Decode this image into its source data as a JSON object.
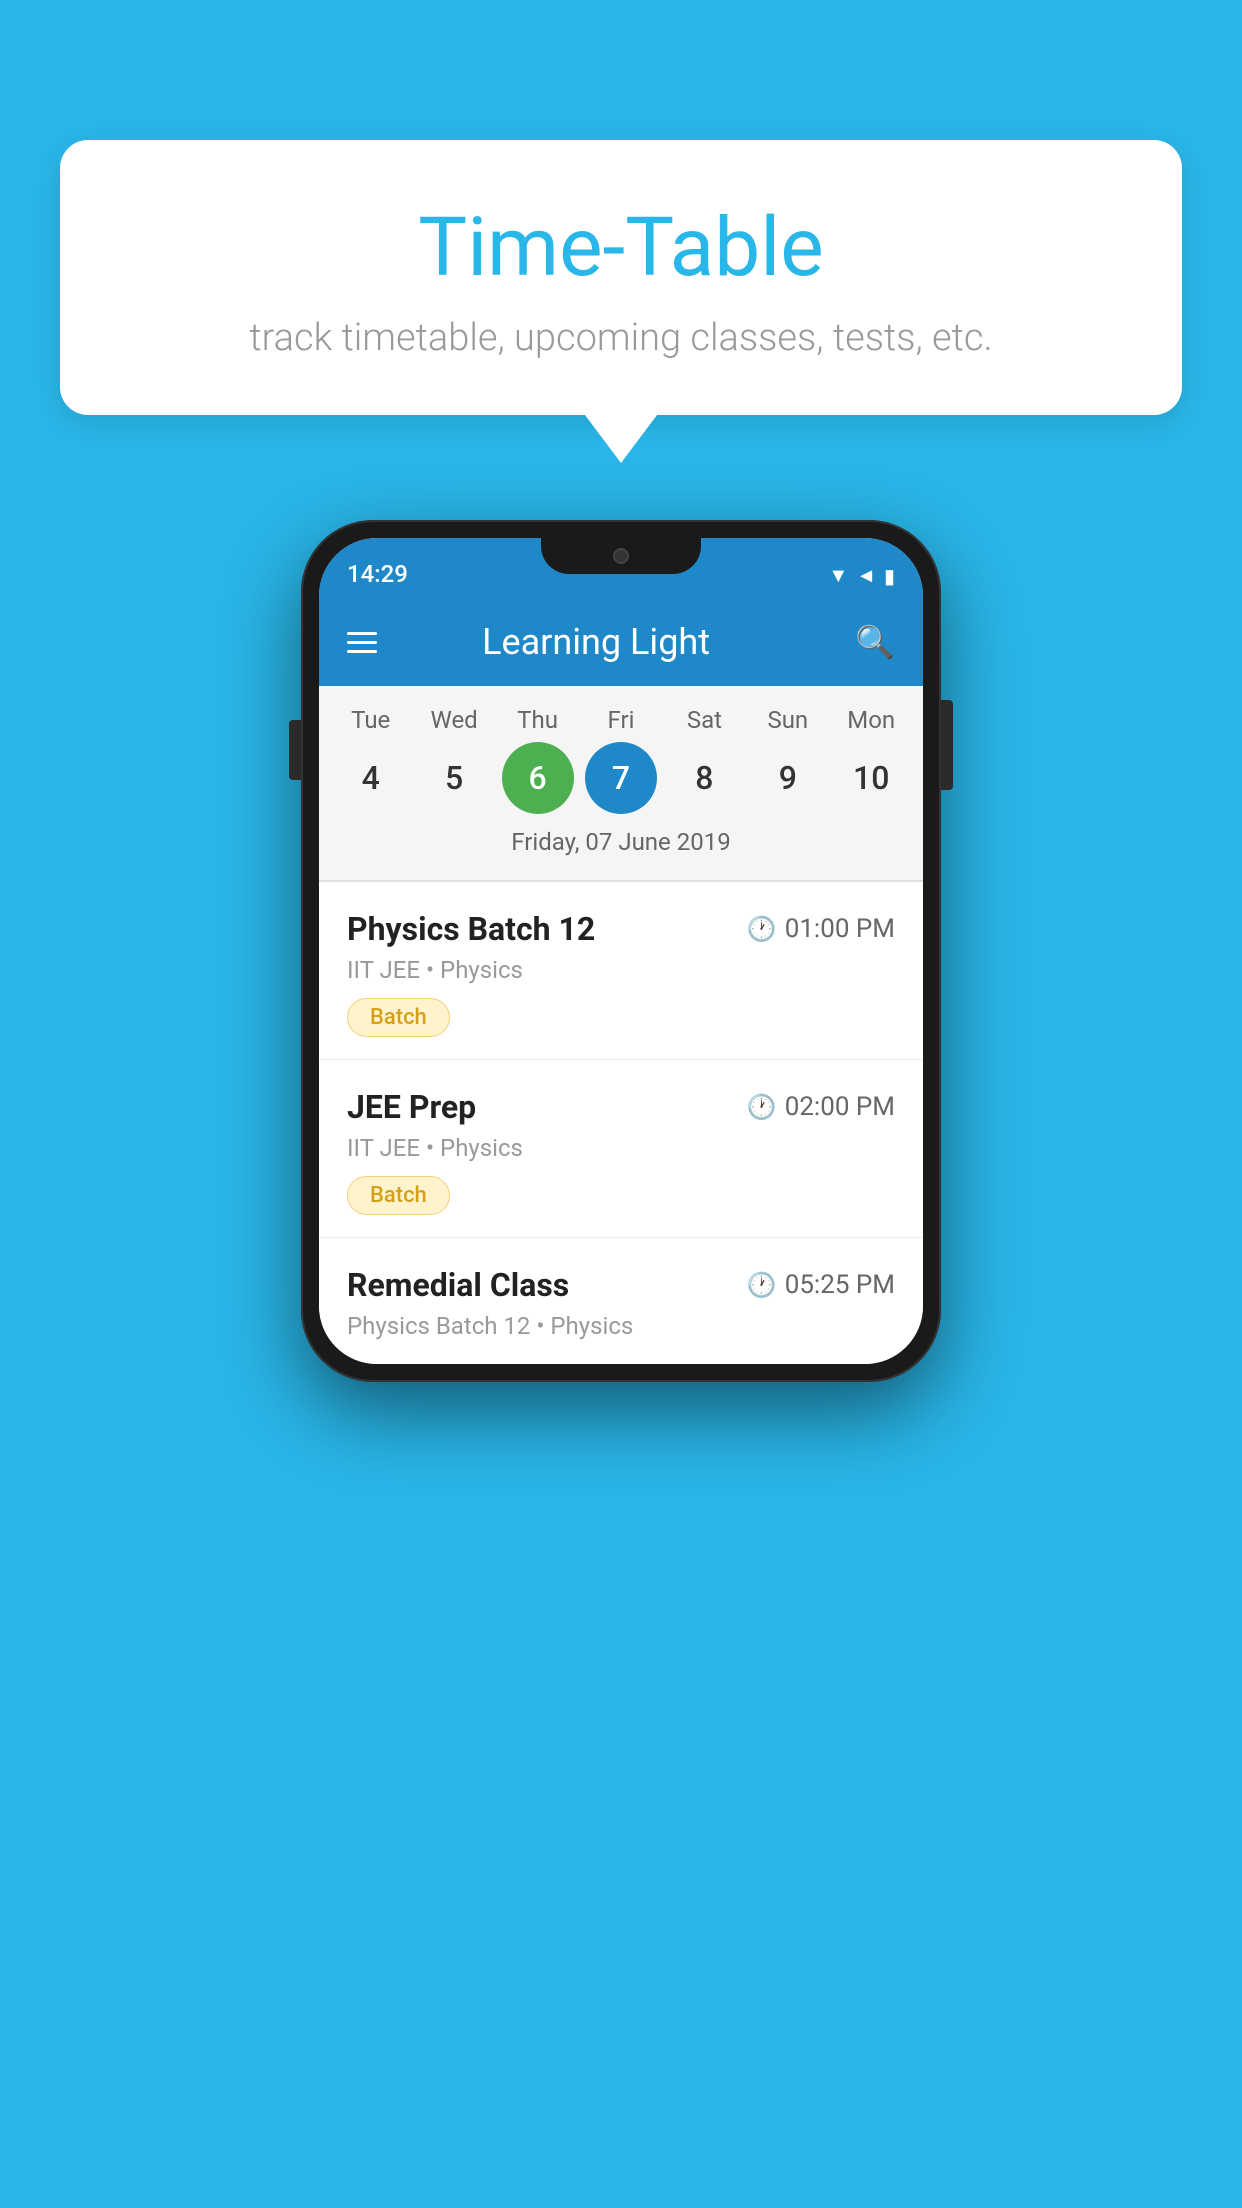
{
  "background_color": "#29B6E8",
  "speech_bubble": {
    "title": "Time-Table",
    "subtitle": "track timetable, upcoming classes, tests, etc."
  },
  "phone": {
    "status_bar": {
      "time": "14:29"
    },
    "header": {
      "title": "Learning Light"
    },
    "calendar": {
      "days": [
        {
          "label": "Tue",
          "num": "4"
        },
        {
          "label": "Wed",
          "num": "5"
        },
        {
          "label": "Thu",
          "num": "6",
          "state": "today"
        },
        {
          "label": "Fri",
          "num": "7",
          "state": "selected"
        },
        {
          "label": "Sat",
          "num": "8"
        },
        {
          "label": "Sun",
          "num": "9"
        },
        {
          "label": "Mon",
          "num": "10"
        }
      ],
      "selected_date_label": "Friday, 07 June 2019"
    },
    "schedule": [
      {
        "name": "Physics Batch 12",
        "time": "01:00 PM",
        "sub": "IIT JEE • Physics",
        "tag": "Batch"
      },
      {
        "name": "JEE Prep",
        "time": "02:00 PM",
        "sub": "IIT JEE • Physics",
        "tag": "Batch"
      },
      {
        "name": "Remedial Class",
        "time": "05:25 PM",
        "sub": "Physics Batch 12 • Physics"
      }
    ]
  }
}
